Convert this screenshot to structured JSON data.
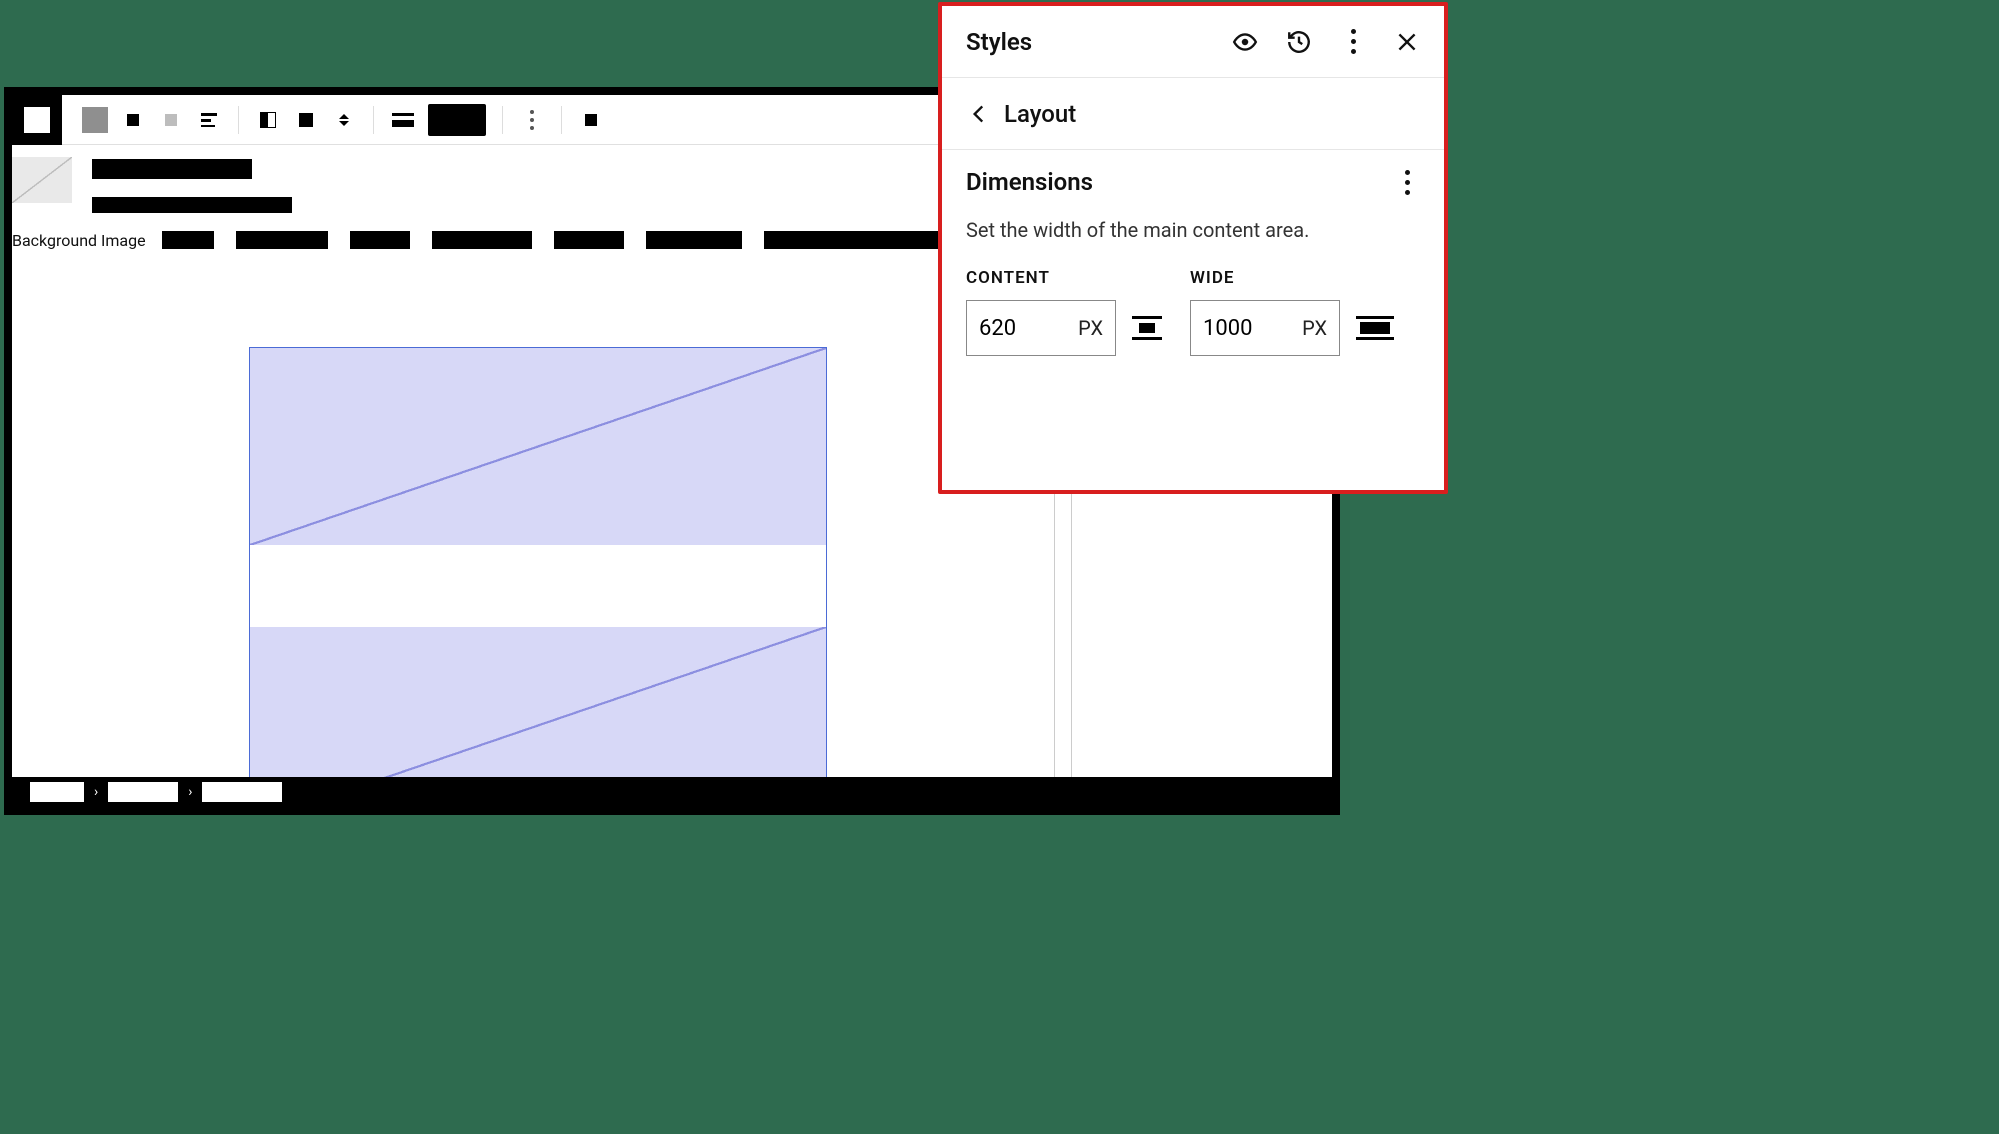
{
  "editor": {
    "background_label": "Background Image",
    "breadcrumb_sep": "›"
  },
  "stylesPanel": {
    "title": "Styles",
    "nav_label": "Layout",
    "section_title": "Dimensions",
    "description": "Set the width of the main content area.",
    "content": {
      "label": "CONTENT",
      "value": "620",
      "unit": "PX"
    },
    "wide": {
      "label": "WIDE",
      "value": "1000",
      "unit": "PX"
    }
  }
}
